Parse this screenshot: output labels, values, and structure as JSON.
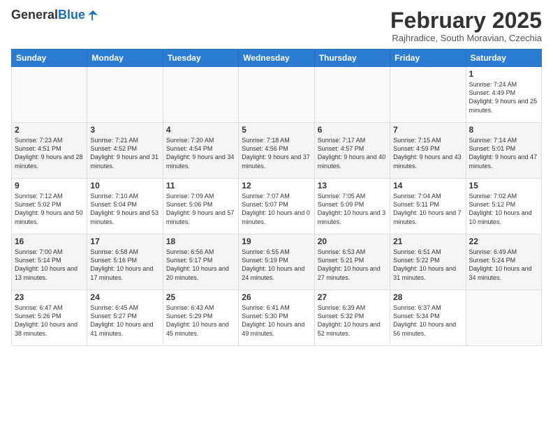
{
  "header": {
    "logo_general": "General",
    "logo_blue": "Blue",
    "month_title": "February 2025",
    "location": "Rajhradice, South Moravian, Czechia"
  },
  "weekdays": [
    "Sunday",
    "Monday",
    "Tuesday",
    "Wednesday",
    "Thursday",
    "Friday",
    "Saturday"
  ],
  "weeks": [
    {
      "days": [
        {
          "num": "",
          "info": ""
        },
        {
          "num": "",
          "info": ""
        },
        {
          "num": "",
          "info": ""
        },
        {
          "num": "",
          "info": ""
        },
        {
          "num": "",
          "info": ""
        },
        {
          "num": "",
          "info": ""
        },
        {
          "num": "1",
          "info": "Sunrise: 7:24 AM\nSunset: 4:49 PM\nDaylight: 9 hours and 25 minutes."
        }
      ]
    },
    {
      "days": [
        {
          "num": "2",
          "info": "Sunrise: 7:23 AM\nSunset: 4:51 PM\nDaylight: 9 hours and 28 minutes."
        },
        {
          "num": "3",
          "info": "Sunrise: 7:21 AM\nSunset: 4:52 PM\nDaylight: 9 hours and 31 minutes."
        },
        {
          "num": "4",
          "info": "Sunrise: 7:20 AM\nSunset: 4:54 PM\nDaylight: 9 hours and 34 minutes."
        },
        {
          "num": "5",
          "info": "Sunrise: 7:18 AM\nSunset: 4:56 PM\nDaylight: 9 hours and 37 minutes."
        },
        {
          "num": "6",
          "info": "Sunrise: 7:17 AM\nSunset: 4:57 PM\nDaylight: 9 hours and 40 minutes."
        },
        {
          "num": "7",
          "info": "Sunrise: 7:15 AM\nSunset: 4:59 PM\nDaylight: 9 hours and 43 minutes."
        },
        {
          "num": "8",
          "info": "Sunrise: 7:14 AM\nSunset: 5:01 PM\nDaylight: 9 hours and 47 minutes."
        }
      ]
    },
    {
      "days": [
        {
          "num": "9",
          "info": "Sunrise: 7:12 AM\nSunset: 5:02 PM\nDaylight: 9 hours and 50 minutes."
        },
        {
          "num": "10",
          "info": "Sunrise: 7:10 AM\nSunset: 5:04 PM\nDaylight: 9 hours and 53 minutes."
        },
        {
          "num": "11",
          "info": "Sunrise: 7:09 AM\nSunset: 5:06 PM\nDaylight: 9 hours and 57 minutes."
        },
        {
          "num": "12",
          "info": "Sunrise: 7:07 AM\nSunset: 5:07 PM\nDaylight: 10 hours and 0 minutes."
        },
        {
          "num": "13",
          "info": "Sunrise: 7:05 AM\nSunset: 5:09 PM\nDaylight: 10 hours and 3 minutes."
        },
        {
          "num": "14",
          "info": "Sunrise: 7:04 AM\nSunset: 5:11 PM\nDaylight: 10 hours and 7 minutes."
        },
        {
          "num": "15",
          "info": "Sunrise: 7:02 AM\nSunset: 5:12 PM\nDaylight: 10 hours and 10 minutes."
        }
      ]
    },
    {
      "days": [
        {
          "num": "16",
          "info": "Sunrise: 7:00 AM\nSunset: 5:14 PM\nDaylight: 10 hours and 13 minutes."
        },
        {
          "num": "17",
          "info": "Sunrise: 6:58 AM\nSunset: 5:16 PM\nDaylight: 10 hours and 17 minutes."
        },
        {
          "num": "18",
          "info": "Sunrise: 6:56 AM\nSunset: 5:17 PM\nDaylight: 10 hours and 20 minutes."
        },
        {
          "num": "19",
          "info": "Sunrise: 6:55 AM\nSunset: 5:19 PM\nDaylight: 10 hours and 24 minutes."
        },
        {
          "num": "20",
          "info": "Sunrise: 6:53 AM\nSunset: 5:21 PM\nDaylight: 10 hours and 27 minutes."
        },
        {
          "num": "21",
          "info": "Sunrise: 6:51 AM\nSunset: 5:22 PM\nDaylight: 10 hours and 31 minutes."
        },
        {
          "num": "22",
          "info": "Sunrise: 6:49 AM\nSunset: 5:24 PM\nDaylight: 10 hours and 34 minutes."
        }
      ]
    },
    {
      "days": [
        {
          "num": "23",
          "info": "Sunrise: 6:47 AM\nSunset: 5:26 PM\nDaylight: 10 hours and 38 minutes."
        },
        {
          "num": "24",
          "info": "Sunrise: 6:45 AM\nSunset: 5:27 PM\nDaylight: 10 hours and 41 minutes."
        },
        {
          "num": "25",
          "info": "Sunrise: 6:43 AM\nSunset: 5:29 PM\nDaylight: 10 hours and 45 minutes."
        },
        {
          "num": "26",
          "info": "Sunrise: 6:41 AM\nSunset: 5:30 PM\nDaylight: 10 hours and 49 minutes."
        },
        {
          "num": "27",
          "info": "Sunrise: 6:39 AM\nSunset: 5:32 PM\nDaylight: 10 hours and 52 minutes."
        },
        {
          "num": "28",
          "info": "Sunrise: 6:37 AM\nSunset: 5:34 PM\nDaylight: 10 hours and 56 minutes."
        },
        {
          "num": "",
          "info": ""
        }
      ]
    }
  ]
}
